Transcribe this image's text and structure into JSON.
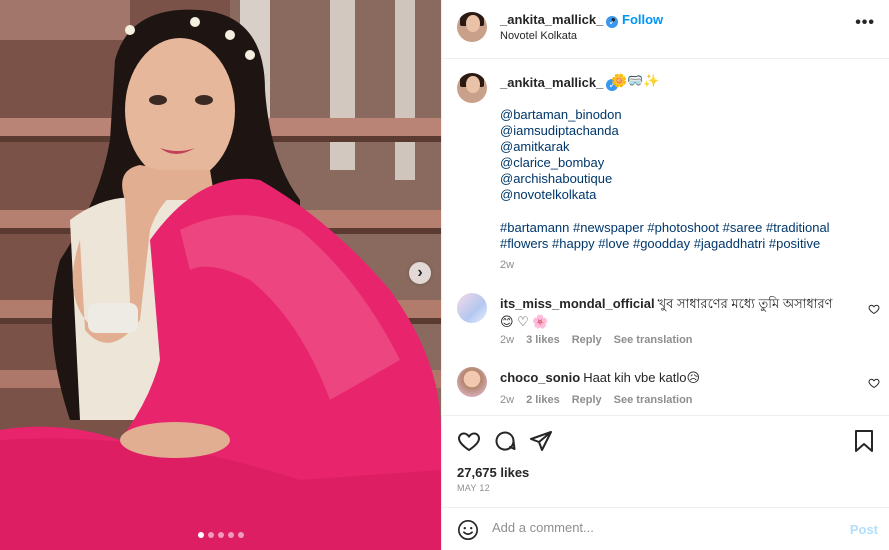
{
  "post": {
    "username": "_ankita_mallick_",
    "location": "Novotel Kolkata",
    "follow_label": "Follow",
    "separator": "•",
    "more_label": "•••",
    "next_arrow": "›",
    "carousel": {
      "count": 5,
      "active_index": 0
    },
    "caption": {
      "username": "_ankita_mallick_",
      "emojis": "🌼🥽✨",
      "mentions": [
        "@bartaman_binodon",
        "@iamsudiptachanda",
        "@amitkarak",
        "@clarice_bombay",
        "@archishaboutique",
        "@novotelkolkata"
      ],
      "hashtags": "#bartamann #newspaper #photoshoot #saree #traditional #flowers #happy #love #goodday #jagaddhatri #positive",
      "time": "2w"
    },
    "comments": [
      {
        "username": "its_miss_mondal_official",
        "text": "খুব সাধারণের মধ্যে তুমি অসাধারণ 😊 ♡ 🌸",
        "time": "2w",
        "likes": "3 likes",
        "reply": "Reply",
        "translation": "See translation"
      },
      {
        "username": "choco_sonio",
        "text": "Haat kih vbe katlo😥",
        "time": "2w",
        "likes": "2 likes",
        "reply": "Reply",
        "translation": "See translation"
      }
    ],
    "likes_count": "27,675 likes",
    "date": "MAY 12",
    "add_comment_placeholder": "Add a comment...",
    "post_button": "Post"
  },
  "colors": {
    "link": "#0095f6",
    "mention": "#00376b",
    "muted": "#8e8e8e",
    "post_disabled": "#b2dffc",
    "saree": "#e8246c",
    "verified": "#3897f0"
  },
  "icons": [
    "verified-badge-icon",
    "more-icon",
    "next-arrow-icon",
    "heart-icon",
    "comment-icon",
    "share-icon",
    "bookmark-icon",
    "emoji-icon"
  ]
}
